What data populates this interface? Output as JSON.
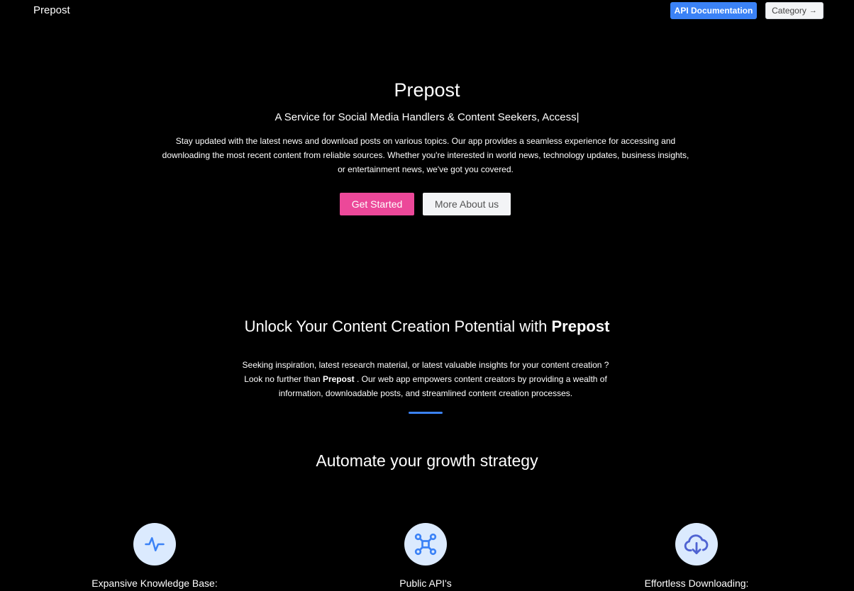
{
  "header": {
    "brand": "Prepost",
    "api_button": "API Documentation",
    "category_button": "Category",
    "category_arrow": "→"
  },
  "hero": {
    "title": "Prepost",
    "subtitle": "A Service for Social Media Handlers & Content Seekers, Access|",
    "description": "Stay updated with the latest news and download posts on various topics. Our app provides a seamless experience for accessing and downloading the most recent content from reliable sources. Whether you're interested in world news, technology updates, business insights, or entertainment news, we've got you covered.",
    "primary_button": "Get Started",
    "secondary_button": "More About us"
  },
  "unlock": {
    "title_prefix": "Unlock Your Content Creation Potential with ",
    "title_brand": "Prepost",
    "desc_part1": "Seeking inspiration, latest research material, or latest valuable insights for your content creation ? Look no further than ",
    "desc_brand": "Prepost",
    "desc_part2": " . Our web app empowers content creators by providing a wealth of information, downloadable posts, and streamlined content creation processes."
  },
  "growth": {
    "title": "Automate your growth strategy"
  },
  "features": [
    {
      "label": "Expansive Knowledge Base:",
      "icon": "activity-icon"
    },
    {
      "label": "Public API's",
      "icon": "network-icon"
    },
    {
      "label": "Effortless Downloading:",
      "icon": "cloud-download-icon"
    }
  ],
  "colors": {
    "accent_blue": "#3b82f6",
    "accent_pink": "#ec4899",
    "icon_bg": "#dbeafe",
    "background": "#000000"
  }
}
